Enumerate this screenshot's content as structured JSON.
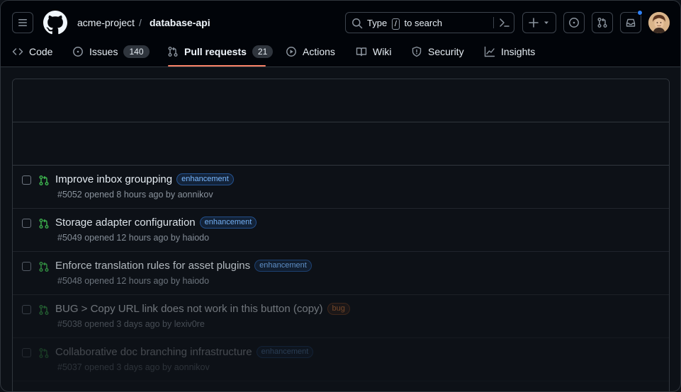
{
  "breadcrumb": {
    "owner": "acme-project",
    "separator": "/",
    "repo": "database-api"
  },
  "search": {
    "prefix": "Type",
    "key": "/",
    "suffix": "to search"
  },
  "tabs": [
    {
      "label": "Code",
      "icon": "code-icon"
    },
    {
      "label": "Issues",
      "icon": "issue-icon",
      "count": "140"
    },
    {
      "label": "Pull requests",
      "icon": "pull-request-icon",
      "count": "21",
      "selected": true
    },
    {
      "label": "Actions",
      "icon": "play-icon"
    },
    {
      "label": "Wiki",
      "icon": "book-icon"
    },
    {
      "label": "Security",
      "icon": "shield-icon"
    },
    {
      "label": "Insights",
      "icon": "graph-icon"
    }
  ],
  "colors": {
    "accent_underline": "#f78166",
    "pr_open": "#3fb950",
    "label_enhancement": "#79b8ff",
    "label_bug": "#f0883e",
    "notification_dot": "#2f81f7"
  },
  "pull_requests": [
    {
      "title": "Improve inbox groupping",
      "label": "enhancement",
      "meta": "#5052 opened 8 hours ago by aonnikov"
    },
    {
      "title": "Storage adapter configuration",
      "label": "enhancement",
      "meta": "#5049 opened 12 hours ago by haiodo"
    },
    {
      "title": "Enforce translation rules for asset plugins",
      "label": "enhancement",
      "meta": "#5048 opened 12 hours ago by haiodo"
    },
    {
      "title": "BUG > Copy URL link does not work in this button (copy)",
      "label": "bug",
      "meta": "#5038 opened 3 days ago by lexiv0re"
    },
    {
      "title": "Collaborative doc branching infrastructure",
      "label": "enhancement",
      "meta": "#5037 opened 3 days ago by aonnikov"
    }
  ]
}
